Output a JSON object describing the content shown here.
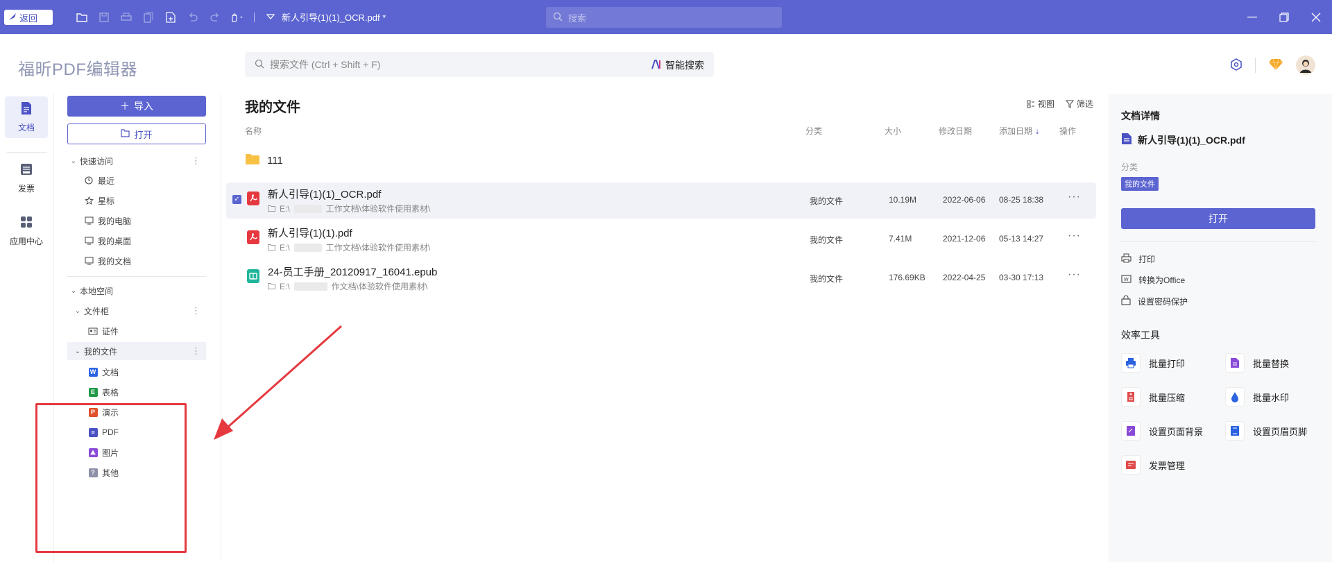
{
  "titlebar": {
    "back_label": "返回",
    "doc_tab": "新人引导(1)(1)_OCR.pdf *",
    "search_placeholder": "搜索"
  },
  "header": {
    "app_title": "福昕PDF编辑器",
    "search_placeholder": "搜索文件 (Ctrl + Shift + F)",
    "ai_search_label": "智能搜索"
  },
  "rail": {
    "items": [
      {
        "label": "文档",
        "icon": "document-icon",
        "active": true
      },
      {
        "label": "发票",
        "icon": "invoice-icon",
        "active": false
      },
      {
        "label": "应用中心",
        "icon": "apps-icon",
        "active": false
      }
    ]
  },
  "sidebar": {
    "import_label": "导入",
    "open_label": "打开",
    "quick_access": "快速访问",
    "quick_items": [
      {
        "label": "最近",
        "icon": "clock-icon"
      },
      {
        "label": "星标",
        "icon": "star-icon"
      },
      {
        "label": "我的电脑",
        "icon": "computer-icon"
      },
      {
        "label": "我的桌面",
        "icon": "desktop-icon"
      },
      {
        "label": "我的文档",
        "icon": "folder-docs-icon"
      }
    ],
    "local_space": "本地空间",
    "cabinet": "文件柜",
    "cabinet_items": [
      {
        "label": "证件",
        "icon": "id-card-icon"
      }
    ],
    "my_files": "我的文件",
    "file_types": [
      {
        "label": "文档",
        "icon": "word-icon",
        "glyph": "W",
        "color": "#2b63e0"
      },
      {
        "label": "表格",
        "icon": "sheet-icon",
        "glyph": "E",
        "color": "#1f9a48"
      },
      {
        "label": "演示",
        "icon": "slides-icon",
        "glyph": "P",
        "color": "#e0502b"
      },
      {
        "label": "PDF",
        "icon": "pdf-icon",
        "glyph": "≡",
        "color": "#4a52c4"
      },
      {
        "label": "图片",
        "icon": "image-icon",
        "glyph": "⛰",
        "color": "#8a4ad8"
      },
      {
        "label": "其他",
        "icon": "other-icon",
        "glyph": "?",
        "color": "#8c90a8"
      }
    ]
  },
  "main": {
    "title": "我的文件",
    "view_label": "视图",
    "filter_label": "筛选",
    "columns": {
      "name": "名称",
      "category": "分类",
      "size": "大小",
      "modified": "修改日期",
      "added": "添加日期",
      "actions": "操作"
    },
    "folder": {
      "name": "111"
    },
    "files": [
      {
        "name": "新人引导(1)(1)_OCR.pdf",
        "path_prefix": "E:\\",
        "path_suffix": "工作文档\\体验软件使用素材\\",
        "category": "我的文件",
        "size": "10.19M",
        "modified": "2022-06-06",
        "added": "08-25 18:38",
        "type": "pdf",
        "selected": true
      },
      {
        "name": "新人引导(1)(1).pdf",
        "path_prefix": "E:\\",
        "path_suffix": "工作文档\\体验软件使用素材\\",
        "category": "我的文件",
        "size": "7.41M",
        "modified": "2021-12-06",
        "added": "05-13 14:27",
        "type": "pdf",
        "selected": false
      },
      {
        "name": "24-员工手册_20120917_16041.epub",
        "path_prefix": "E:\\",
        "path_suffix": "作文档\\体验软件使用素材\\",
        "category": "我的文件",
        "size": "176.69KB",
        "modified": "2022-04-25",
        "added": "03-30 17:13",
        "type": "epub",
        "selected": false
      }
    ]
  },
  "details": {
    "title": "文档详情",
    "file_name": "新人引导(1)(1)_OCR.pdf",
    "category_label": "分类",
    "category_value": "我的文件",
    "open_label": "打开",
    "actions": [
      {
        "label": "打印",
        "icon": "printer-icon"
      },
      {
        "label": "转换为Office",
        "icon": "convert-office-icon"
      },
      {
        "label": "设置密码保护",
        "icon": "lock-icon"
      }
    ],
    "tools_title": "效率工具",
    "tools": [
      {
        "label": "批量打印",
        "icon": "batch-print-icon",
        "color": "#2b63e0"
      },
      {
        "label": "批量替换",
        "icon": "batch-replace-icon",
        "color": "#8a4ad8"
      },
      {
        "label": "批量压缩",
        "icon": "batch-compress-icon",
        "color": "#e04a4a"
      },
      {
        "label": "批量水印",
        "icon": "batch-watermark-icon",
        "color": "#2b63e0"
      },
      {
        "label": "设置页面背景",
        "icon": "page-background-icon",
        "color": "#8a4ad8"
      },
      {
        "label": "设置页眉页脚",
        "icon": "header-footer-icon",
        "color": "#2b63e0"
      },
      {
        "label": "发票管理",
        "icon": "invoice-manage-icon",
        "color": "#e04a4a"
      }
    ]
  }
}
